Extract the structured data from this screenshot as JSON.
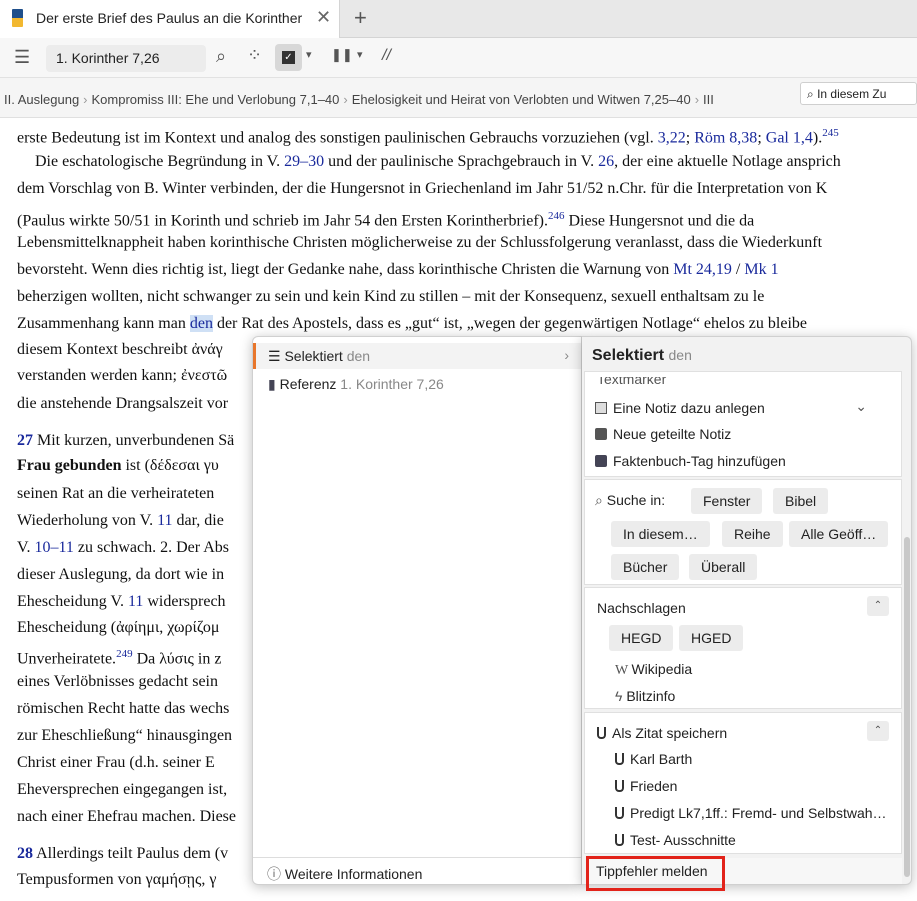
{
  "tab": {
    "title": "Der erste Brief des Paulus an die Korinther",
    "close": "✕",
    "new": "+"
  },
  "toolbar": {
    "reference": "1. Korinther 7,26",
    "menu": "☰",
    "search": "⌕",
    "parallel": "⁘",
    "columns": "❚❚",
    "dropdown": "▾",
    "slashes": "//"
  },
  "breadcrumb": [
    "II. Auslegung",
    "Kompromiss III: Ehe und Verlobung 7,1–40",
    "Ehelosigkeit und Heirat von Verlobten und Witwen 7,25–40",
    "III"
  ],
  "breadcrumb_sep": "›",
  "search_placeholder": "In diesem Zu",
  "document": {
    "l1a": "erste Bedeutung ist im Kontext und analog des sonstigen paulinischen Gebrauchs vorzuziehen (vgl. ",
    "l1r1": "3,22",
    "l1r2": "Röm 8,38",
    "l1r3": "Gal 1,4",
    "l1sup": "245",
    "l2a": "Die eschatologische Begründung in V. ",
    "l2r1": "29–30",
    "l2b": " und der paulinische Sprachgebrauch in V. ",
    "l2r2": "26",
    "l2c": ", der eine aktuelle Notlage ansprich",
    "l3": "dem Vorschlag von B. Winter verbinden, der die Hungersnot in Griechenland im Jahr 51/52 n.Chr. für die Interpretation von K",
    "l4a": "(Paulus wirkte 50/51 in Korinth und schrieb im Jahr 54 den Ersten Korintherbrief).",
    "l4sup": "246",
    "l4b": " Diese Hungersnot und die da",
    "l5": "Lebensmittelknappheit haben korinthische Christen möglicherweise zu der Schlussfolgerung veranlasst, dass die Wiederkunft",
    "l6a": "bevorsteht. Wenn dies richtig ist, liegt der Gedanke nahe, dass korinthische Christen die Warnung von ",
    "l6r1": "Mt 24,19",
    "l6r2": "Mk 1",
    "l7": "beherzigen wollten, nicht schwanger zu sein und kein Kind zu stillen – mit der Konsequenz, sexuell enthaltsam zu le",
    "l8a": "Zusammenhang kann man ",
    "l8hl": "den",
    "l8b": " der Rat des Apostels, dass es „gut“ ist, „wegen der gegenwärtigen Notlage“ ehelos zu bleibe",
    "l9": "diesem Kontext beschreibt ἀνάγ",
    "l10": "verstanden werden kann; ἐνεστῶ",
    "l11": "die anstehende Drangsalszeit vor",
    "l12n": "27",
    "l12": " Mit kurzen, unverbundenen Sä",
    "l13b": "Frau gebunden",
    "l13": " ist (δέδεσαι γυ",
    "l14": "seinen Rat an die verheirateten",
    "l15a": "Wiederholung von V. ",
    "l15r": "11",
    "l15b": " dar, die",
    "l16a": "V. ",
    "l16r": "10–11",
    "l16b": " zu schwach. 2. Der Abs",
    "l17": "dieser Auslegung, da dort wie in",
    "l18a": "Ehescheidung V. ",
    "l18r": "11",
    "l18b": " widersprech",
    "l19": "Ehescheidung (ἀφίημι, χωρίζομ",
    "l20a": "Unverheiratete.",
    "l20sup": "249",
    "l20b": " Da λύσις in z",
    "l21": "eines Verlöbnisses gedacht sein",
    "l22": "römischen Recht hatte das wechs",
    "l23": "zur Eheschließung“ hinausgingen",
    "l24": "Christ einer Frau (d.h. seiner E",
    "l25": "Eheversprechen eingegangen ist,",
    "l26": "nach einer Ehefrau machen. Diese",
    "l27n": "28",
    "l27": " Allerdings teilt Paulus dem (v",
    "l28": "Tempusformen von γαμήσῃς, γ"
  },
  "context_menu": {
    "selected_label": "Selektiert",
    "selected_word": "den",
    "arrow": "›",
    "reference_label": "Referenz",
    "reference_value": "1. Korinther 7,26",
    "info": "Weitere Informationen"
  },
  "panel": {
    "title": "Selektiert",
    "title_word": "den",
    "highlighter": "Textmarker",
    "add_note": "Eine Notiz dazu anlegen",
    "shared_note": "Neue geteilte Notiz",
    "factbook": "Faktenbuch-Tag hinzufügen",
    "search_label": "Suche in:",
    "search_chips": [
      "Fenster",
      "Bibel",
      "In diesem…",
      "Reihe",
      "Alle Geöff…",
      "Bücher",
      "Überall"
    ],
    "lookup_label": "Nachschlagen",
    "lookup_chips": [
      "HEGD",
      "HGED"
    ],
    "wikipedia": "Wikipedia",
    "blitzinfo": "Blitzinfo",
    "clip_label": "Als Zitat speichern",
    "clip_items": [
      "Karl Barth",
      "Frieden",
      "Predigt Lk7,1ff.: Fremd- und Selbstwah…",
      "Test- Ausschnitte"
    ],
    "typo": "Tippfehler melden",
    "collapse": "⌃",
    "expand": "⌄"
  }
}
